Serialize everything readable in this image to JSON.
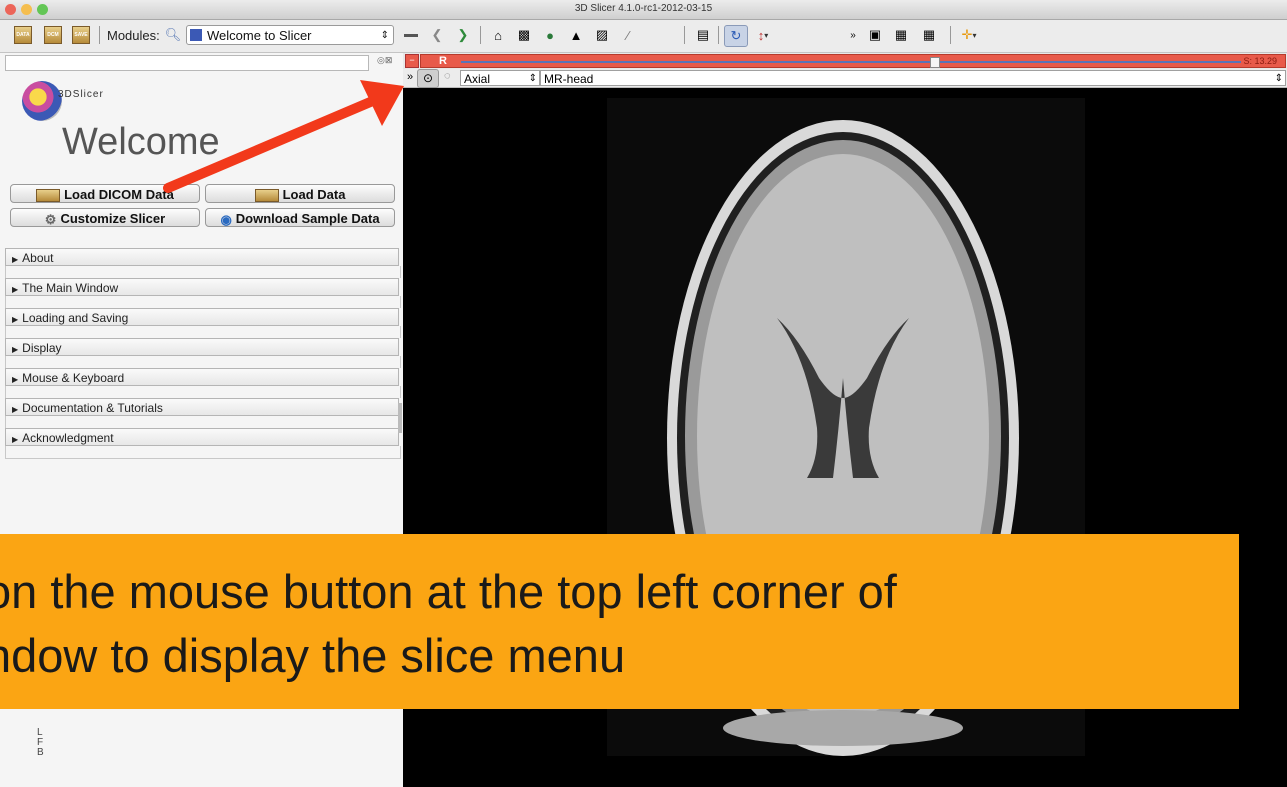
{
  "window": {
    "title": "3D Slicer 4.1.0-rc1-2012-03-15"
  },
  "toolbar": {
    "data_icon_label": "DATA",
    "dcm_icon_label": "DCM",
    "save_icon_label": "SAVE",
    "modules_label": "Modules:",
    "module_selected": "Welcome to Slicer"
  },
  "left_panel": {
    "logo_text": "3DSlicer",
    "welcome_title": "Welcome",
    "buttons": {
      "load_dicom": "Load DICOM Data",
      "load_data": "Load Data",
      "customize": "Customize Slicer",
      "download_sample": "Download Sample Data"
    },
    "sections": [
      "About",
      "The Main Window",
      "Loading and Saving",
      "Display",
      "Mouse & Keyboard",
      "Documentation & Tutorials",
      "Acknowledgment"
    ],
    "orientation_labels": [
      "L",
      "F",
      "B"
    ]
  },
  "slice_view": {
    "letter": "R",
    "offset_label": "S: 13.29",
    "orientation": "Axial",
    "volume": "MR-head"
  },
  "caption": {
    "line1": "on the mouse button at the top left corner of",
    "line2": "ndow to display the slice menu"
  },
  "colors": {
    "slice_red": "#e85a4a",
    "caption_orange": "#fba513",
    "arrow_red": "#f2391b"
  }
}
